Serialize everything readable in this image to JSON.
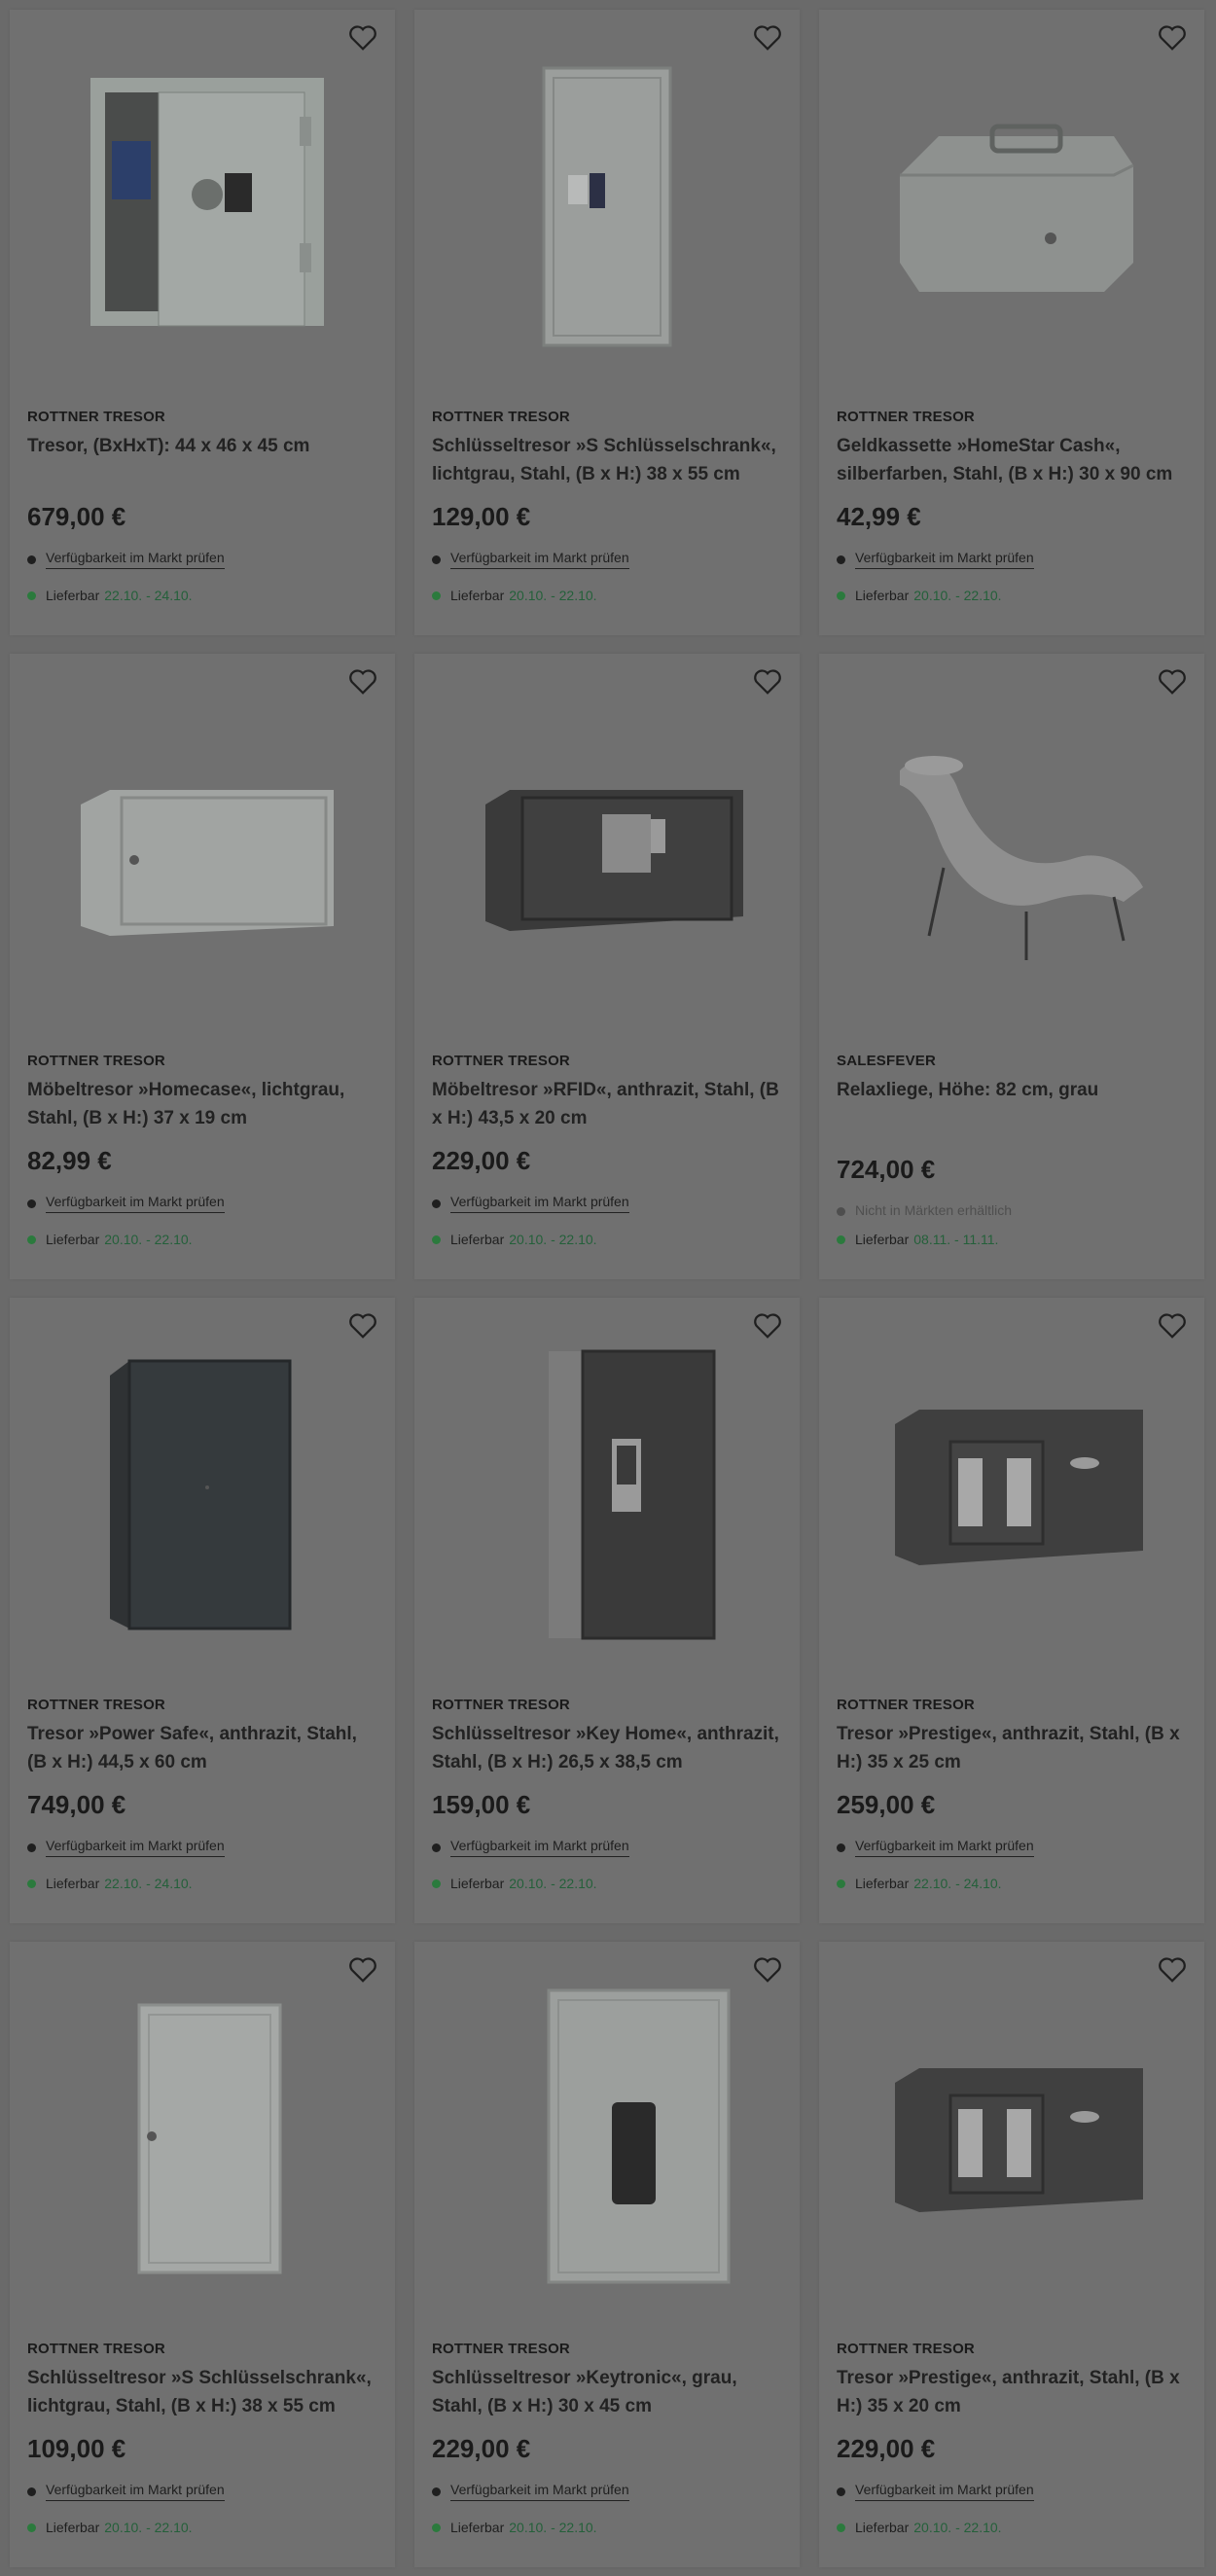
{
  "products": [
    {
      "brand": "ROTTNER TRESOR",
      "title": "Tresor, (BxHxT): 44 x 46 x 45 cm",
      "price": "679,00 €",
      "availability": "Verfügbarkeit im Markt prüfen",
      "delivery_label": "Lieferbar",
      "delivery_dates": "22.10. - 24.10.",
      "image_icon": "safe-open-icon"
    },
    {
      "brand": "ROTTNER TRESOR",
      "title": "Schlüsseltresor »S Schlüsselschrank«, lichtgrau, Stahl, (B x H:) 38 x 55 cm",
      "price": "129,00 €",
      "availability": "Verfügbarkeit im Markt prüfen",
      "delivery_label": "Lieferbar",
      "delivery_dates": "20.10. - 22.10.",
      "image_icon": "key-cabinet-icon"
    },
    {
      "brand": "ROTTNER TRESOR",
      "title": "Geldkassette »HomeStar Cash«, silberfarben, Stahl, (B x H:) 30 x 90 cm",
      "price": "42,99 €",
      "availability": "Verfügbarkeit im Markt prüfen",
      "delivery_label": "Lieferbar",
      "delivery_dates": "20.10. - 22.10.",
      "image_icon": "cash-box-icon"
    },
    {
      "brand": "ROTTNER TRESOR",
      "title": "Möbeltresor »Homecase«, lichtgrau, Stahl, (B x H:) 37 x 19 cm",
      "price": "82,99 €",
      "availability": "Verfügbarkeit im Markt prüfen",
      "delivery_label": "Lieferbar",
      "delivery_dates": "20.10. - 22.10.",
      "image_icon": "furniture-safe-icon"
    },
    {
      "brand": "ROTTNER TRESOR",
      "title": "Möbeltresor »RFID«, anthrazit, Stahl, (B x H:) 43,5 x 20 cm",
      "price": "229,00 €",
      "availability": "Verfügbarkeit im Markt prüfen",
      "delivery_label": "Lieferbar",
      "delivery_dates": "20.10. - 22.10.",
      "image_icon": "rfid-safe-icon"
    },
    {
      "brand": "SALESFEVER",
      "title": "Relaxliege, Höhe: 82 cm, grau",
      "price": "724,00 €",
      "availability": "Nicht in Märkten erhältlich",
      "delivery_label": "Lieferbar",
      "delivery_dates": "08.11. - 11.11.",
      "image_icon": "lounge-chair-icon"
    },
    {
      "brand": "ROTTNER TRESOR",
      "title": "Tresor »Power Safe«, anthrazit, Stahl, (B x H:) 44,5 x 60 cm",
      "price": "749,00 €",
      "availability": "Verfügbarkeit im Markt prüfen",
      "delivery_label": "Lieferbar",
      "delivery_dates": "22.10. - 24.10.",
      "image_icon": "power-safe-icon"
    },
    {
      "brand": "ROTTNER TRESOR",
      "title": "Schlüsseltresor »Key Home«, anthrazit, Stahl, (B x H:) 26,5 x 38,5 cm",
      "price": "159,00 €",
      "availability": "Verfügbarkeit im Markt prüfen",
      "delivery_label": "Lieferbar",
      "delivery_dates": "20.10. - 22.10.",
      "image_icon": "key-home-safe-icon"
    },
    {
      "brand": "ROTTNER TRESOR",
      "title": "Tresor »Prestige«, anthrazit, Stahl, (B x H:) 35 x 25 cm",
      "price": "259,00 €",
      "availability": "Verfügbarkeit im Markt prüfen",
      "delivery_label": "Lieferbar",
      "delivery_dates": "22.10. - 24.10.",
      "image_icon": "prestige-safe-icon"
    },
    {
      "brand": "ROTTNER TRESOR",
      "title": "Schlüsseltresor »S Schlüsselschrank«, lichtgrau, Stahl, (B x H:) 38 x 55 cm",
      "price": "109,00 €",
      "availability": "Verfügbarkeit im Markt prüfen",
      "delivery_label": "Lieferbar",
      "delivery_dates": "20.10. - 22.10.",
      "image_icon": "key-cabinet-light-icon"
    },
    {
      "brand": "ROTTNER TRESOR",
      "title": "Schlüsseltresor »Keytronic«, grau, Stahl, (B x H:) 30 x 45 cm",
      "price": "229,00 €",
      "availability": "Verfügbarkeit im Markt prüfen",
      "delivery_label": "Lieferbar",
      "delivery_dates": "20.10. - 22.10.",
      "image_icon": "keytronic-safe-icon"
    },
    {
      "brand": "ROTTNER TRESOR",
      "title": "Tresor »Prestige«, anthrazit, Stahl, (B x H:) 35 x 20 cm",
      "price": "229,00 €",
      "availability": "Verfügbarkeit im Markt prüfen",
      "delivery_label": "Lieferbar",
      "delivery_dates": "20.10. - 22.10.",
      "image_icon": "prestige-safe-small-icon"
    }
  ]
}
